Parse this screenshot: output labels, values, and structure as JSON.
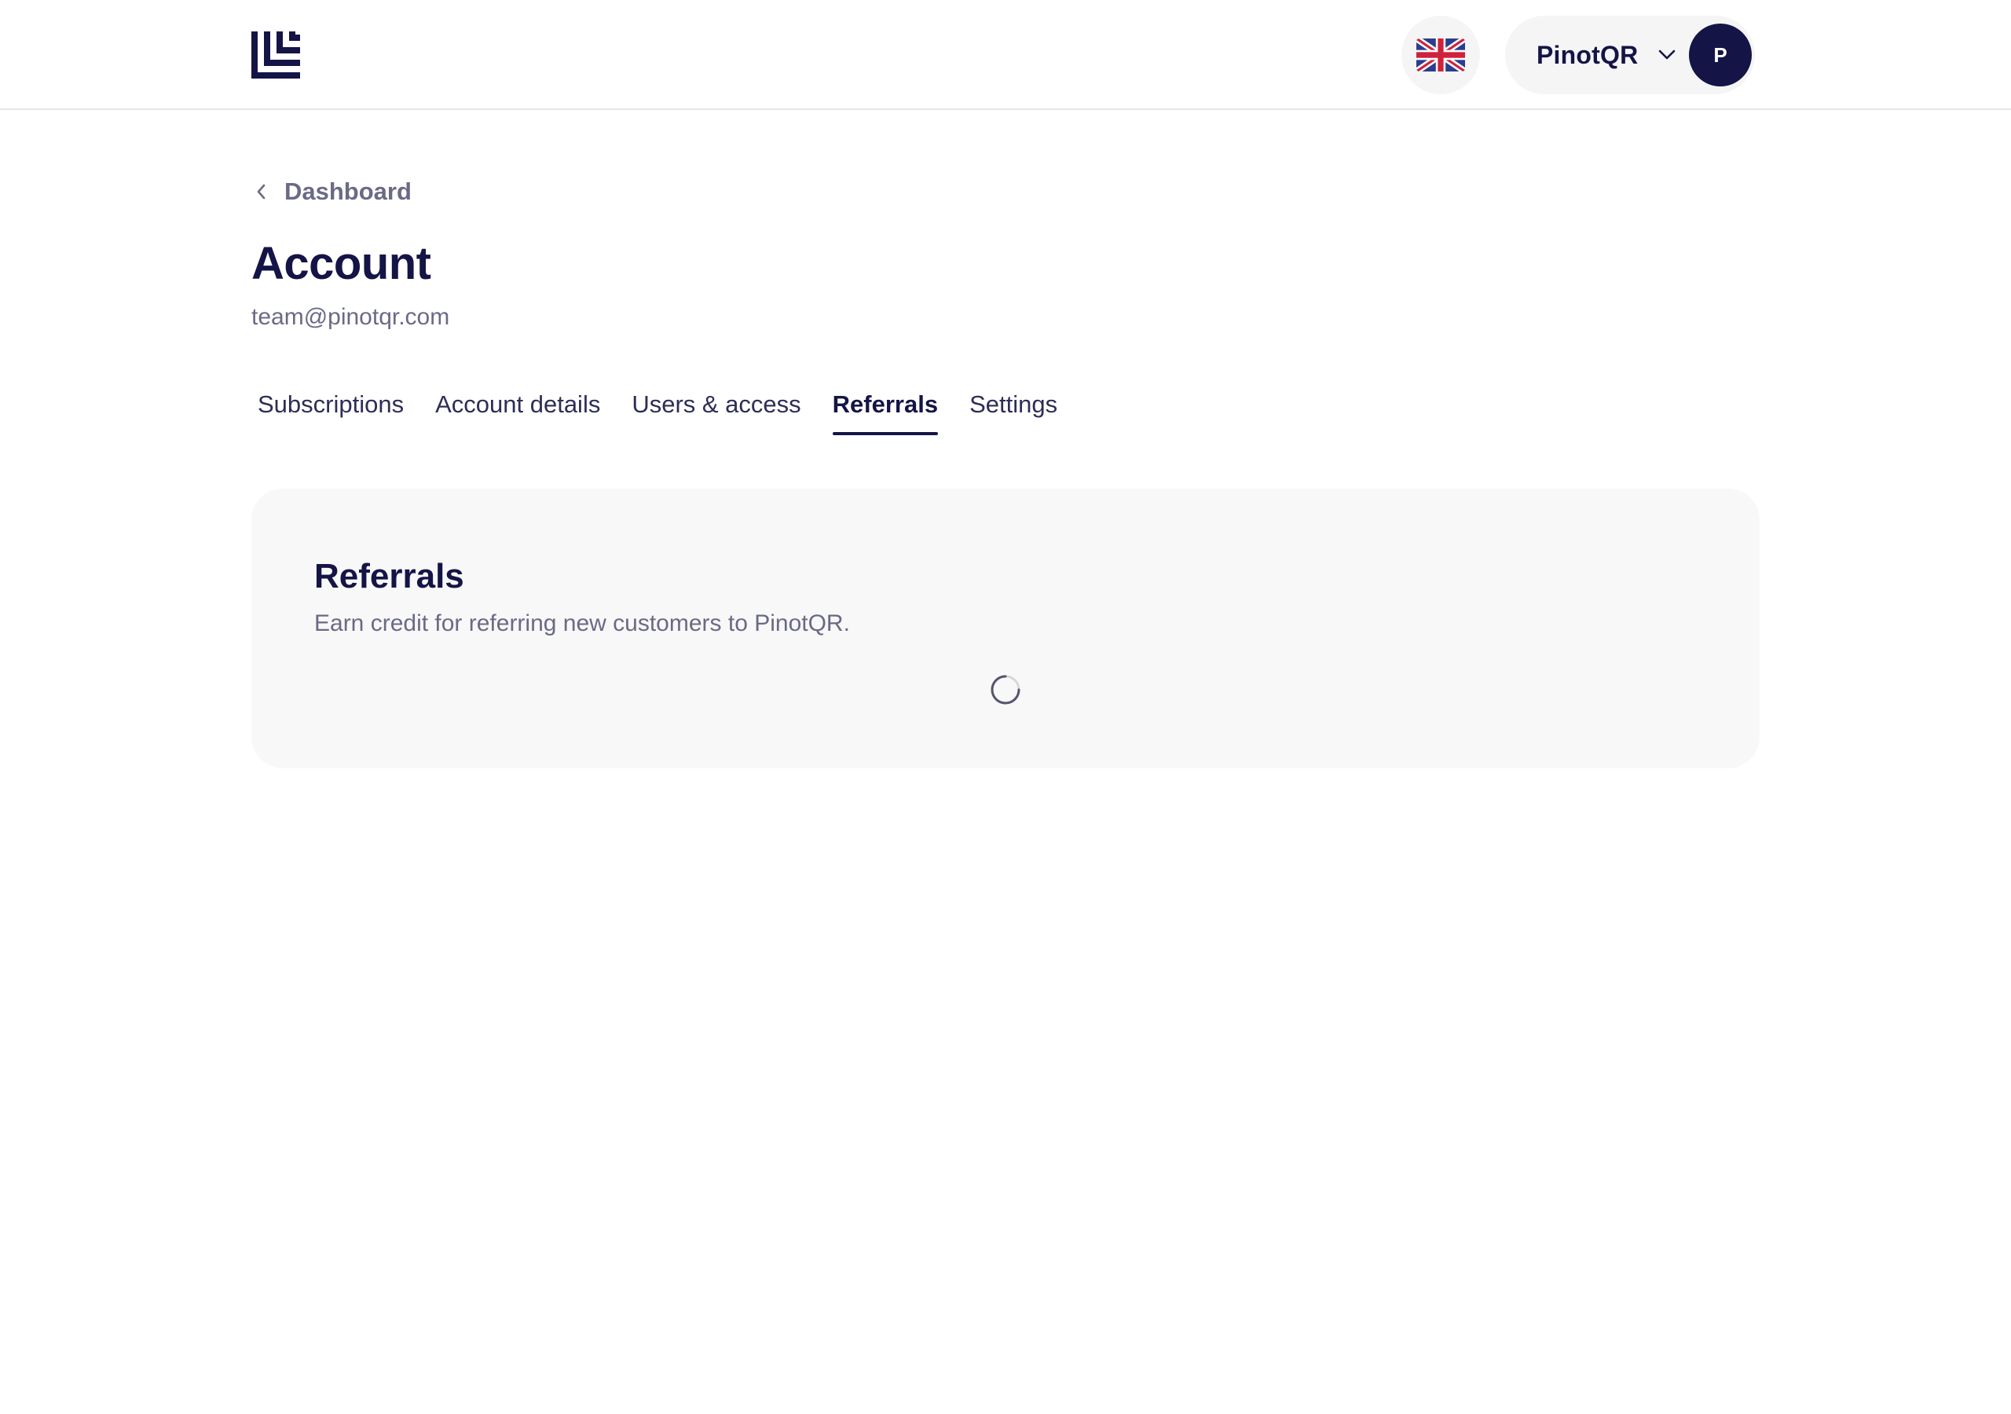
{
  "header": {
    "logo_icon": "brand-logo-icon",
    "language_icon": "uk-flag-icon",
    "account_name": "PinotQR",
    "avatar_initial": "P",
    "chevron_icon": "chevron-down-icon"
  },
  "breadcrumb": {
    "back_label": "Dashboard",
    "back_icon": "chevron-left-icon"
  },
  "page": {
    "title": "Account",
    "email": "team@pinotqr.com"
  },
  "tabs": [
    {
      "label": "Subscriptions",
      "active": false
    },
    {
      "label": "Account details",
      "active": false
    },
    {
      "label": "Users & access",
      "active": false
    },
    {
      "label": "Referrals",
      "active": true
    },
    {
      "label": "Settings",
      "active": false
    }
  ],
  "referrals_card": {
    "title": "Referrals",
    "description": "Earn credit for referring new customers to PinotQR.",
    "loading_icon": "spinner-icon"
  },
  "colors": {
    "brand_navy": "#141447",
    "muted_text": "#6a6a86",
    "card_background": "#f8f8f8",
    "pill_background": "#f5f5f6"
  }
}
